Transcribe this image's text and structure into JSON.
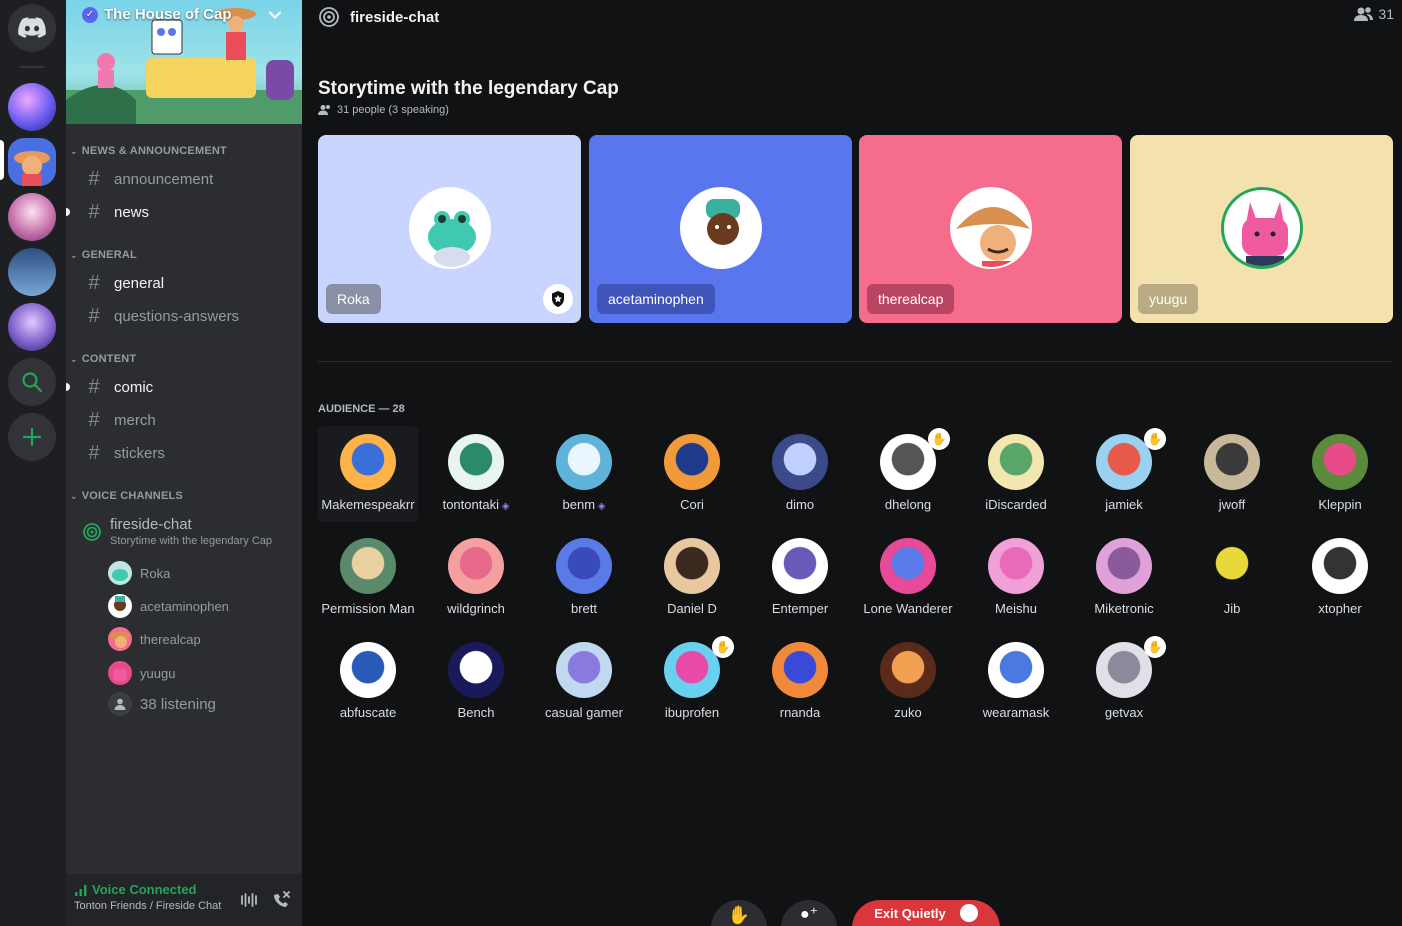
{
  "server": {
    "name": "The House of Cap"
  },
  "categories": {
    "news": "NEWS & ANNOUNCEMENT",
    "general": "GENERAL",
    "content": "CONTENT",
    "voice": "VOICE CHANNELS"
  },
  "channels": {
    "announcement": "announcement",
    "news": "news",
    "general": "general",
    "questions": "questions-answers",
    "comic": "comic",
    "merch": "merch",
    "stickers": "stickers"
  },
  "stage_channel": {
    "name": "fireside-chat",
    "topic": "Storytime with the legendary Cap",
    "users": [
      "Roka",
      "acetaminophen",
      "therealcap",
      "yuugu"
    ],
    "listening": "38 listening"
  },
  "voice_status": {
    "title": "Voice Connected",
    "subtitle": "Tonton Friends / Fireside Chat"
  },
  "header": {
    "channel": "fireside-chat",
    "member_count": "31"
  },
  "stage": {
    "title": "Storytime with the legendary Cap",
    "subtitle": "31 people (3 speaking)"
  },
  "speakers": [
    {
      "name": "Roka",
      "color": "#c9d4ff"
    },
    {
      "name": "acetaminophen",
      "color": "#5a76ee"
    },
    {
      "name": "therealcap",
      "color": "#f56c8c"
    },
    {
      "name": "yuugu",
      "color": "#f3e2ad"
    }
  ],
  "audience": {
    "heading": "AUDIENCE — 28",
    "members": [
      "Makemespeakrr",
      "tontontaki",
      "benm",
      "Cori",
      "dimo",
      "dhelong",
      "iDiscarded",
      "jamiek",
      "jwoff",
      "Kleppin",
      "Permission Man",
      "wildgrinch",
      "brett",
      "Daniel D",
      "Entemper",
      "Lone Wanderer",
      "Meishu",
      "Miketronic",
      "Jib",
      "xtopher",
      "abfuscate",
      "Bench",
      "casual gamer",
      "ibuprofen",
      "rnanda",
      "zuko",
      "wearamask",
      "getvax"
    ]
  },
  "controls": {
    "leave": "Exit Quietly"
  },
  "icons": {
    "discord": "discord-logo-icon",
    "search": "search-icon",
    "add": "plus-icon",
    "hash": "hash-icon",
    "stage": "stage-icon",
    "people": "people-icon",
    "hand": "raised-hand-icon",
    "shield": "moderator-shield-icon"
  }
}
